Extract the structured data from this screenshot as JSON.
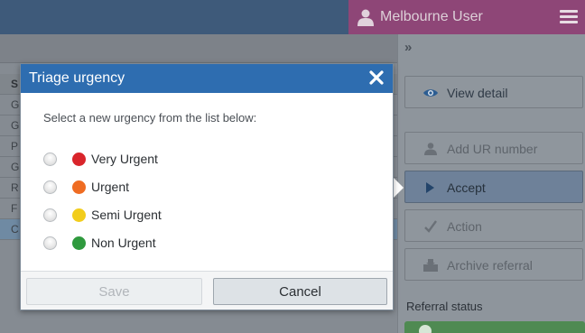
{
  "header": {
    "user_name": "Melbourne User",
    "user_icon": "user-icon",
    "menu_icon": "hamburger-menu-icon"
  },
  "background_list": {
    "header_initial": "S",
    "rows": [
      "G",
      "G",
      "P",
      "G",
      "R",
      "F",
      "C"
    ]
  },
  "side_panel": {
    "collapse_glyph": "»",
    "buttons": [
      {
        "label": "View detail",
        "icon": "eye-icon"
      },
      {
        "label": "Add UR number",
        "icon": "person-icon"
      },
      {
        "label": "Accept",
        "icon": "play-icon"
      },
      {
        "label": "Action",
        "icon": "check-icon"
      },
      {
        "label": "Archive referral",
        "icon": "archive-icon"
      }
    ],
    "status_label": "Referral status"
  },
  "dialog": {
    "title": "Triage urgency",
    "prompt": "Select a new urgency from the list below:",
    "options": [
      {
        "label": "Very Urgent",
        "color": "#d9252b"
      },
      {
        "label": "Urgent",
        "color": "#ef6c22"
      },
      {
        "label": "Semi Urgent",
        "color": "#f2cd1c"
      },
      {
        "label": "Non Urgent",
        "color": "#2f9a3e"
      }
    ],
    "save_label": "Save",
    "cancel_label": "Cancel"
  },
  "colors": {
    "header_bar": "#3e5a7a",
    "user_tab": "#8e4677",
    "dialog_header": "#2e6db0"
  }
}
